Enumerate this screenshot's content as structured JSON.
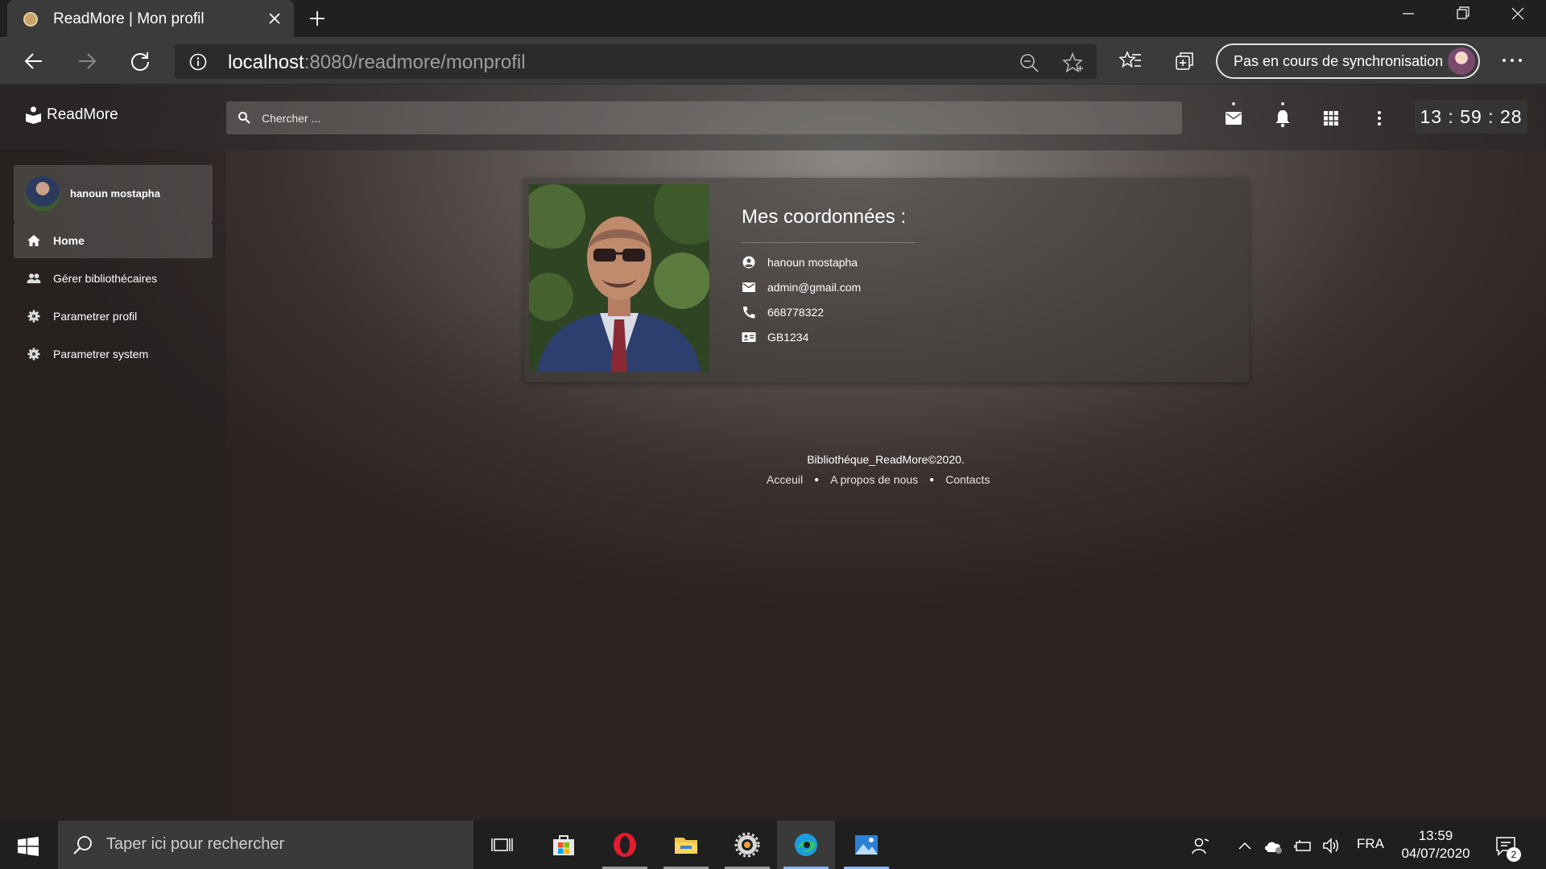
{
  "browser": {
    "tab_title": "ReadMore | Mon profil",
    "url_host": "localhost",
    "url_path": ":8080/readmore/monprofil",
    "sync_label": "Pas en cours de synchronisation"
  },
  "app": {
    "brand": "ReadMore",
    "search_placeholder": "Chercher ...",
    "clock": "13 : 59 : 28"
  },
  "sidebar": {
    "user_name": "hanoun mostapha",
    "items": [
      {
        "label": "Home",
        "icon": "home-icon",
        "active": true
      },
      {
        "label": "Gérer bibliothécaires",
        "icon": "people-icon",
        "active": false
      },
      {
        "label": "Parametrer profil",
        "icon": "gear-icon",
        "active": false
      },
      {
        "label": "Parametrer system",
        "icon": "gear-icon",
        "active": false
      }
    ]
  },
  "profile": {
    "title": "Mes coordonnées :",
    "name": "hanoun mostapha",
    "email": "admin@gmail.com",
    "phone": "668778322",
    "id_card": "GB1234"
  },
  "footer": {
    "copyright": "Bibliothéque_ReadMore©2020.",
    "links": [
      "Acceuil",
      "A propos de nous",
      "Contacts"
    ]
  },
  "taskbar": {
    "search_placeholder": "Taper ici pour rechercher",
    "language": "FRA",
    "time": "13:59",
    "date": "04/07/2020",
    "notification_count": "2"
  },
  "colors": {
    "accent": "#8ab4f8",
    "taskbar": "#1f1f1f",
    "chrome": "#3b3b3b"
  }
}
